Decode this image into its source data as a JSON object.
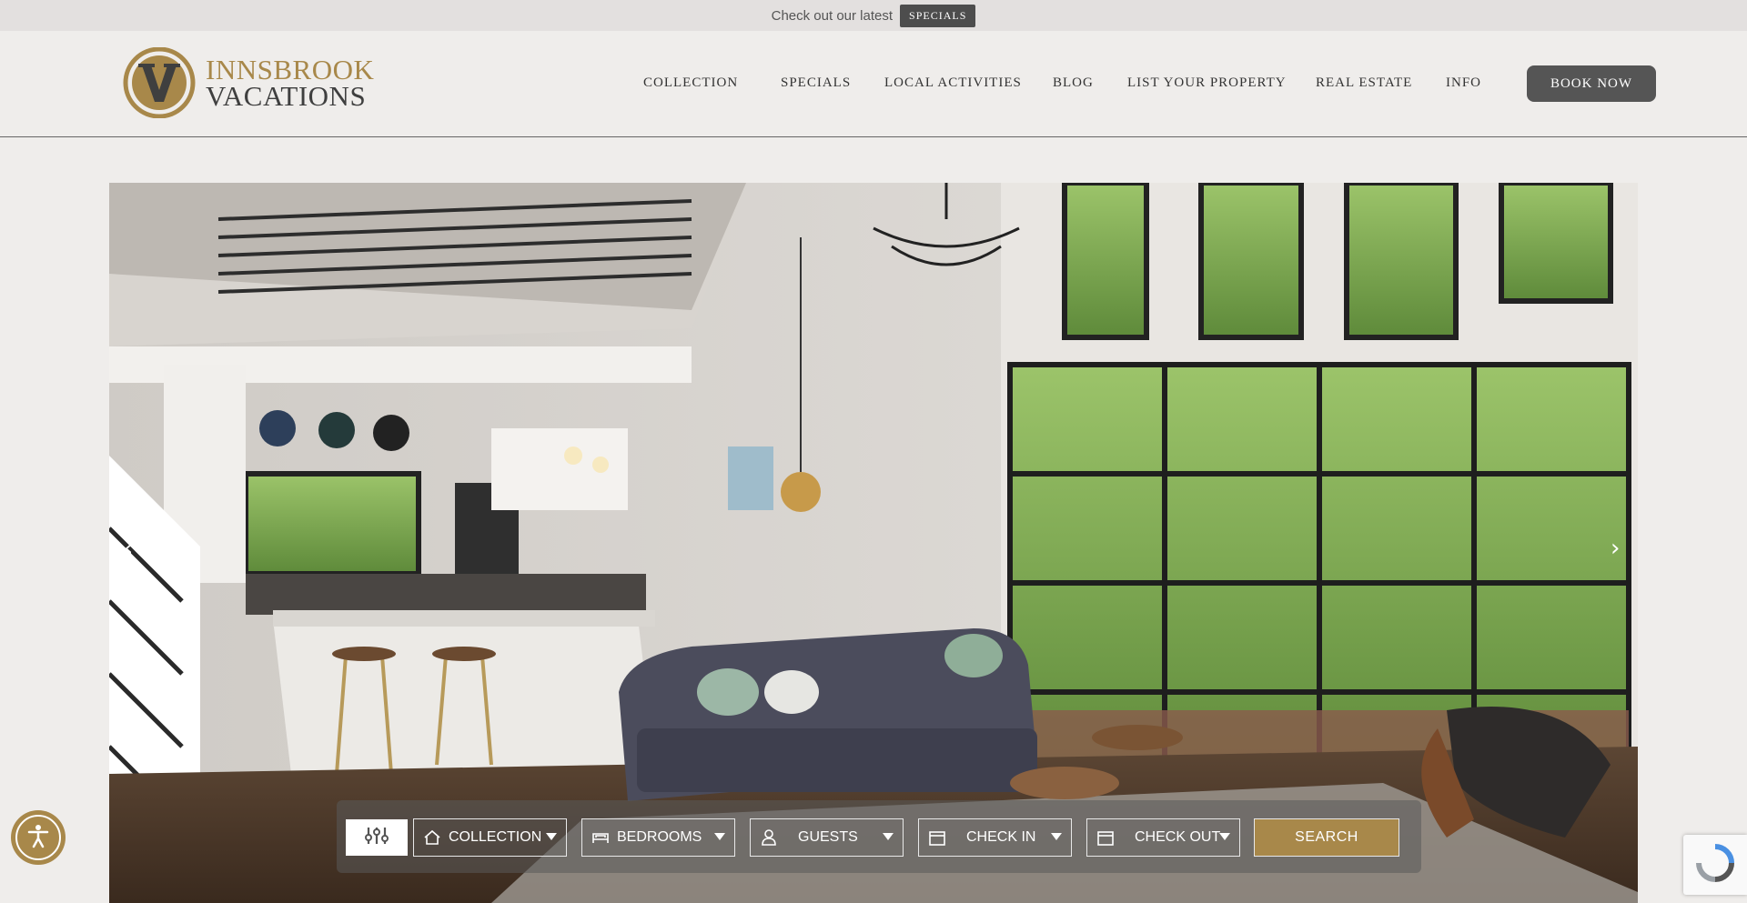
{
  "promo": {
    "text": "Check out our latest",
    "button_label": "SPECIALS"
  },
  "logo": {
    "line1": "INNSBROOK",
    "line2": "VACATIONS",
    "mark_letter": "V"
  },
  "nav": {
    "items": [
      {
        "label": "COLLECTION"
      },
      {
        "label": "SPECIALS"
      },
      {
        "label": "LOCAL ACTIVITIES"
      },
      {
        "label": "BLOG"
      },
      {
        "label": "LIST YOUR PROPERTY"
      },
      {
        "label": "REAL ESTATE"
      },
      {
        "label": "INFO"
      }
    ],
    "book_label": "BOOK NOW"
  },
  "hero": {
    "prev_arrow": "‹",
    "next_arrow": "›"
  },
  "search": {
    "fields": [
      {
        "label": "COLLECTION",
        "icon": "home-icon"
      },
      {
        "label": "BEDROOMS",
        "icon": "bed-icon"
      },
      {
        "label": "GUESTS",
        "icon": "person-icon"
      },
      {
        "label": "CHECK IN",
        "icon": "calendar-icon"
      },
      {
        "label": "CHECK OUT",
        "icon": "calendar-icon"
      }
    ],
    "filter_icon": "sliders-icon",
    "button_label": "SEARCH"
  },
  "colors": {
    "accent_gold": "#a8884a",
    "dark_button": "#555555",
    "background": "#efedeb"
  }
}
